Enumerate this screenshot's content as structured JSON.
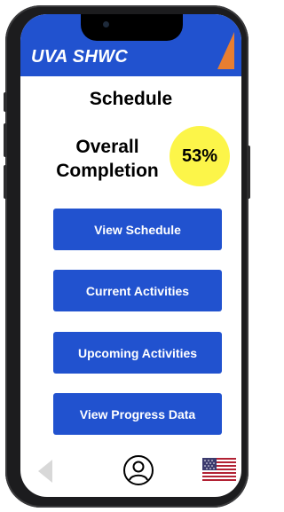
{
  "app": {
    "brand": "UVA SHWC"
  },
  "page": {
    "title": "Schedule"
  },
  "completion": {
    "label_line1": "Overall",
    "label_line2": "Completion",
    "value": "53%"
  },
  "menu": {
    "items": [
      {
        "label": "View Schedule"
      },
      {
        "label": "Current Activities"
      },
      {
        "label": "Upcoming Activities"
      },
      {
        "label": "View Progress Data"
      }
    ]
  },
  "bottom_nav": {
    "back_icon": "back-triangle-icon",
    "profile_icon": "user-profile-icon",
    "language_icon": "us-flag-icon"
  },
  "colors": {
    "primary_blue": "#2152cf",
    "badge_yellow": "#fcf549",
    "logo_orange": "#e87e31",
    "device_frame": "#1c1c1e"
  }
}
